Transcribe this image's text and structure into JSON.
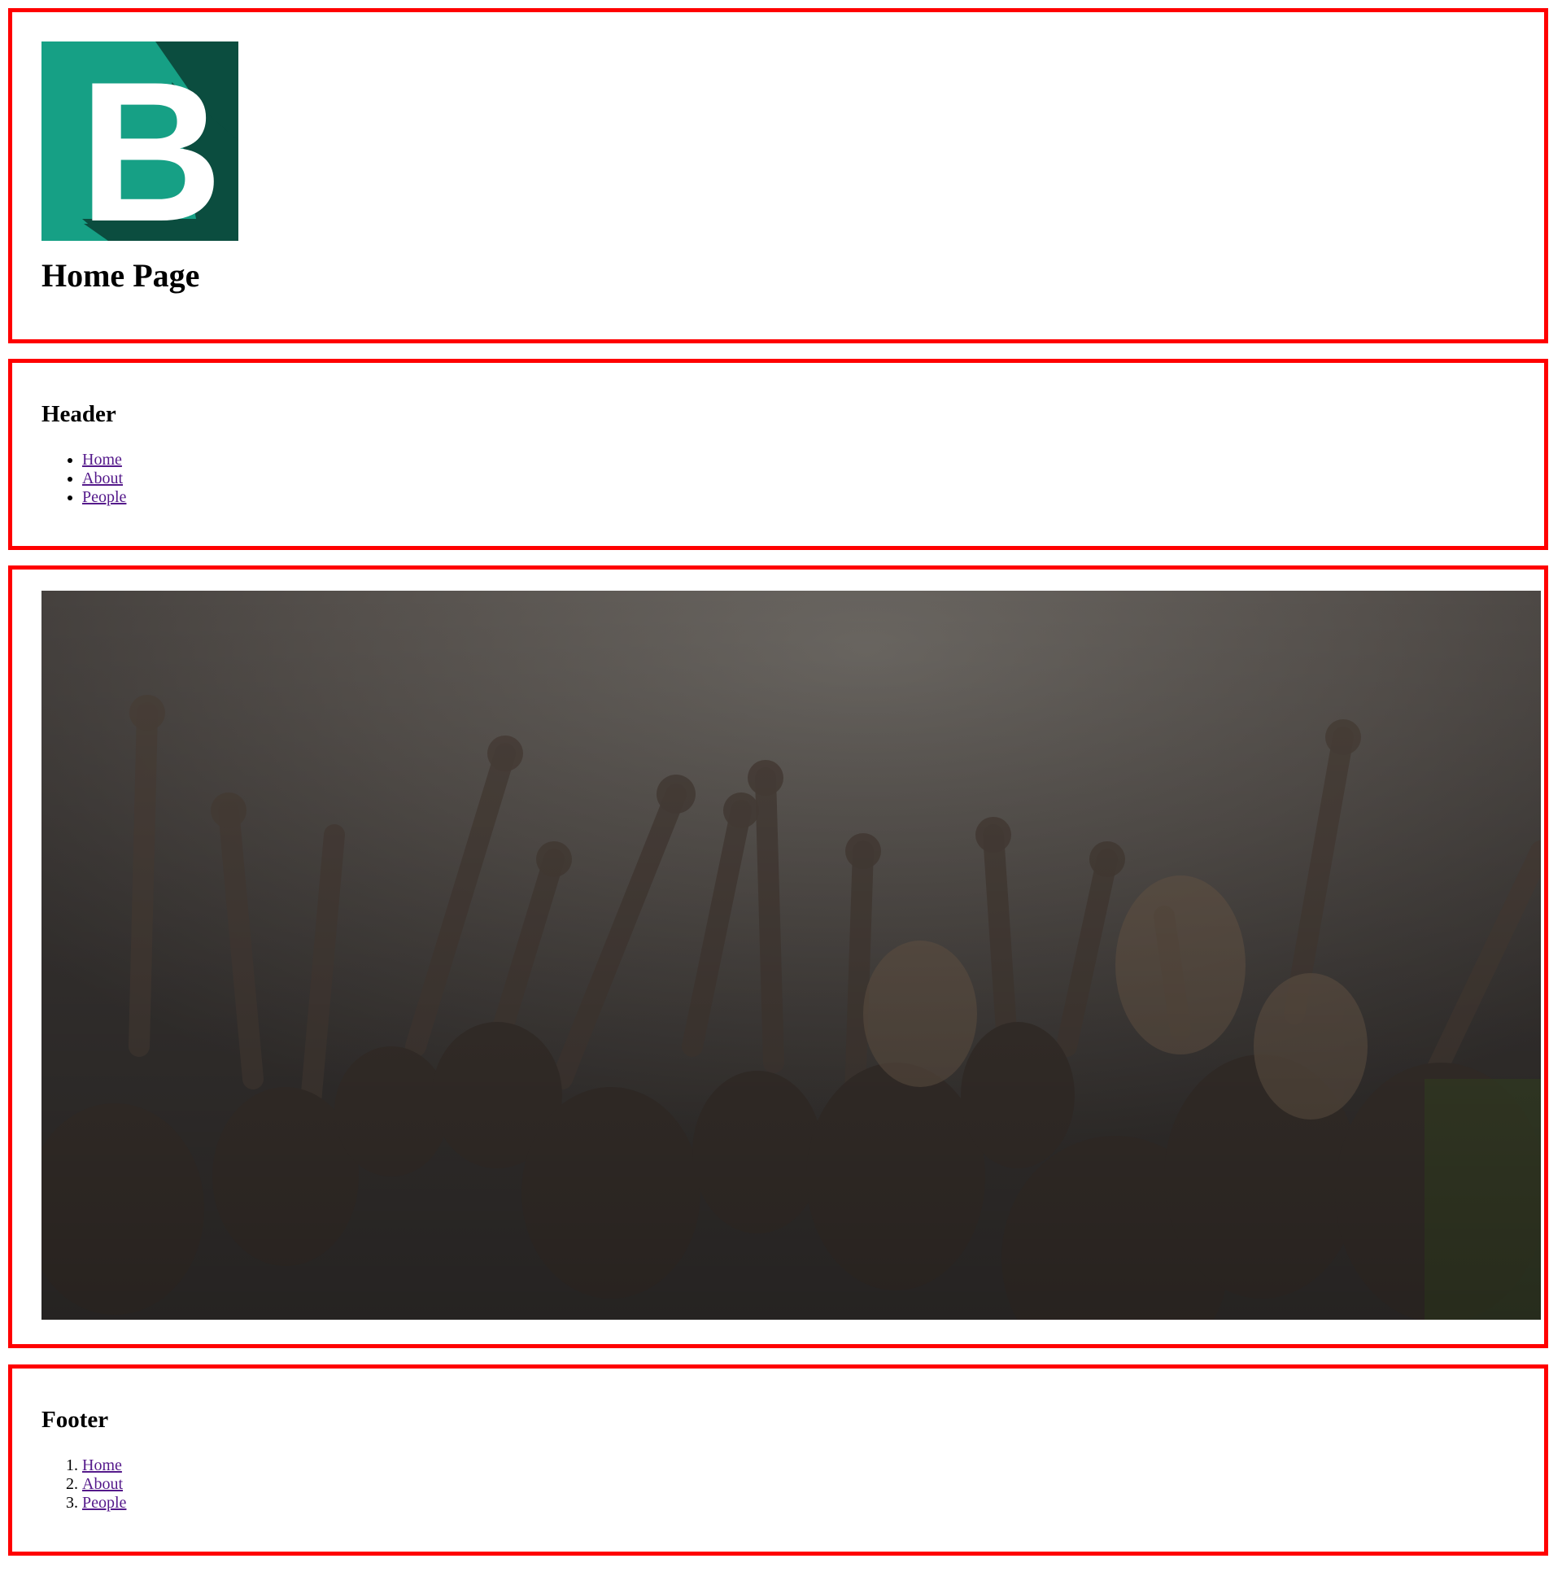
{
  "logo": {
    "letter": "B",
    "icon": "b-logo-icon",
    "bg_color": "#16a085",
    "shadow_color": "#0b4d3f"
  },
  "page_title": "Home Page",
  "header": {
    "title": "Header",
    "links": [
      {
        "label": "Home"
      },
      {
        "label": "About"
      },
      {
        "label": "People"
      }
    ]
  },
  "hero": {
    "image": "concert-crowd-image"
  },
  "footer": {
    "title": "Footer",
    "links": [
      {
        "label": "Home"
      },
      {
        "label": "About"
      },
      {
        "label": "People"
      }
    ]
  },
  "colors": {
    "border": "#ff0000",
    "link": "#551a8b"
  }
}
